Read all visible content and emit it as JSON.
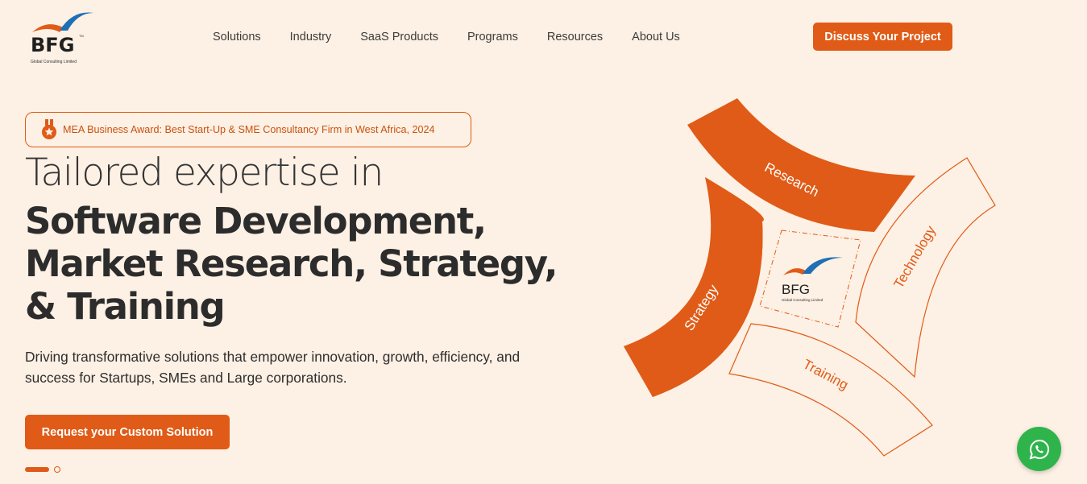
{
  "brand": {
    "logo_text": "BFG",
    "logo_tagline": "Global Consulting Limited",
    "logo_tm": "TM",
    "accent_color": "#e05b17",
    "swoosh_color": "#1e6fb5"
  },
  "nav": {
    "items": [
      {
        "label": "Solutions"
      },
      {
        "label": "Industry"
      },
      {
        "label": "SaaS Products"
      },
      {
        "label": "Programs"
      },
      {
        "label": "Resources"
      },
      {
        "label": "About Us"
      }
    ],
    "cta_label": "Discuss Your Project"
  },
  "hero": {
    "award_icon": "medal-icon",
    "award_text": "MEA Business Award: Best Start-Up & SME Consultancy Firm in West Africa, 2024",
    "headline_light": "Tailored expertise in",
    "headline_lines": [
      "Software Development,",
      "Market Research, Strategy,",
      "& Training"
    ],
    "description": "Driving transformative solutions that empower innovation, growth, efficiency, and success for Startups, SMEs and Large corporations.",
    "cta_label": "Request your Custom Solution",
    "slide_current": 1,
    "slide_total": 2
  },
  "graphic": {
    "segments": [
      {
        "label": "Research",
        "filled": true
      },
      {
        "label": "Technology",
        "filled": false
      },
      {
        "label": "Training",
        "filled": false
      },
      {
        "label": "Strategy",
        "filled": true
      }
    ],
    "center_logo_text": "BFG",
    "center_logo_tagline": "Global Consulting Limited"
  },
  "chat": {
    "icon": "whatsapp-icon"
  }
}
